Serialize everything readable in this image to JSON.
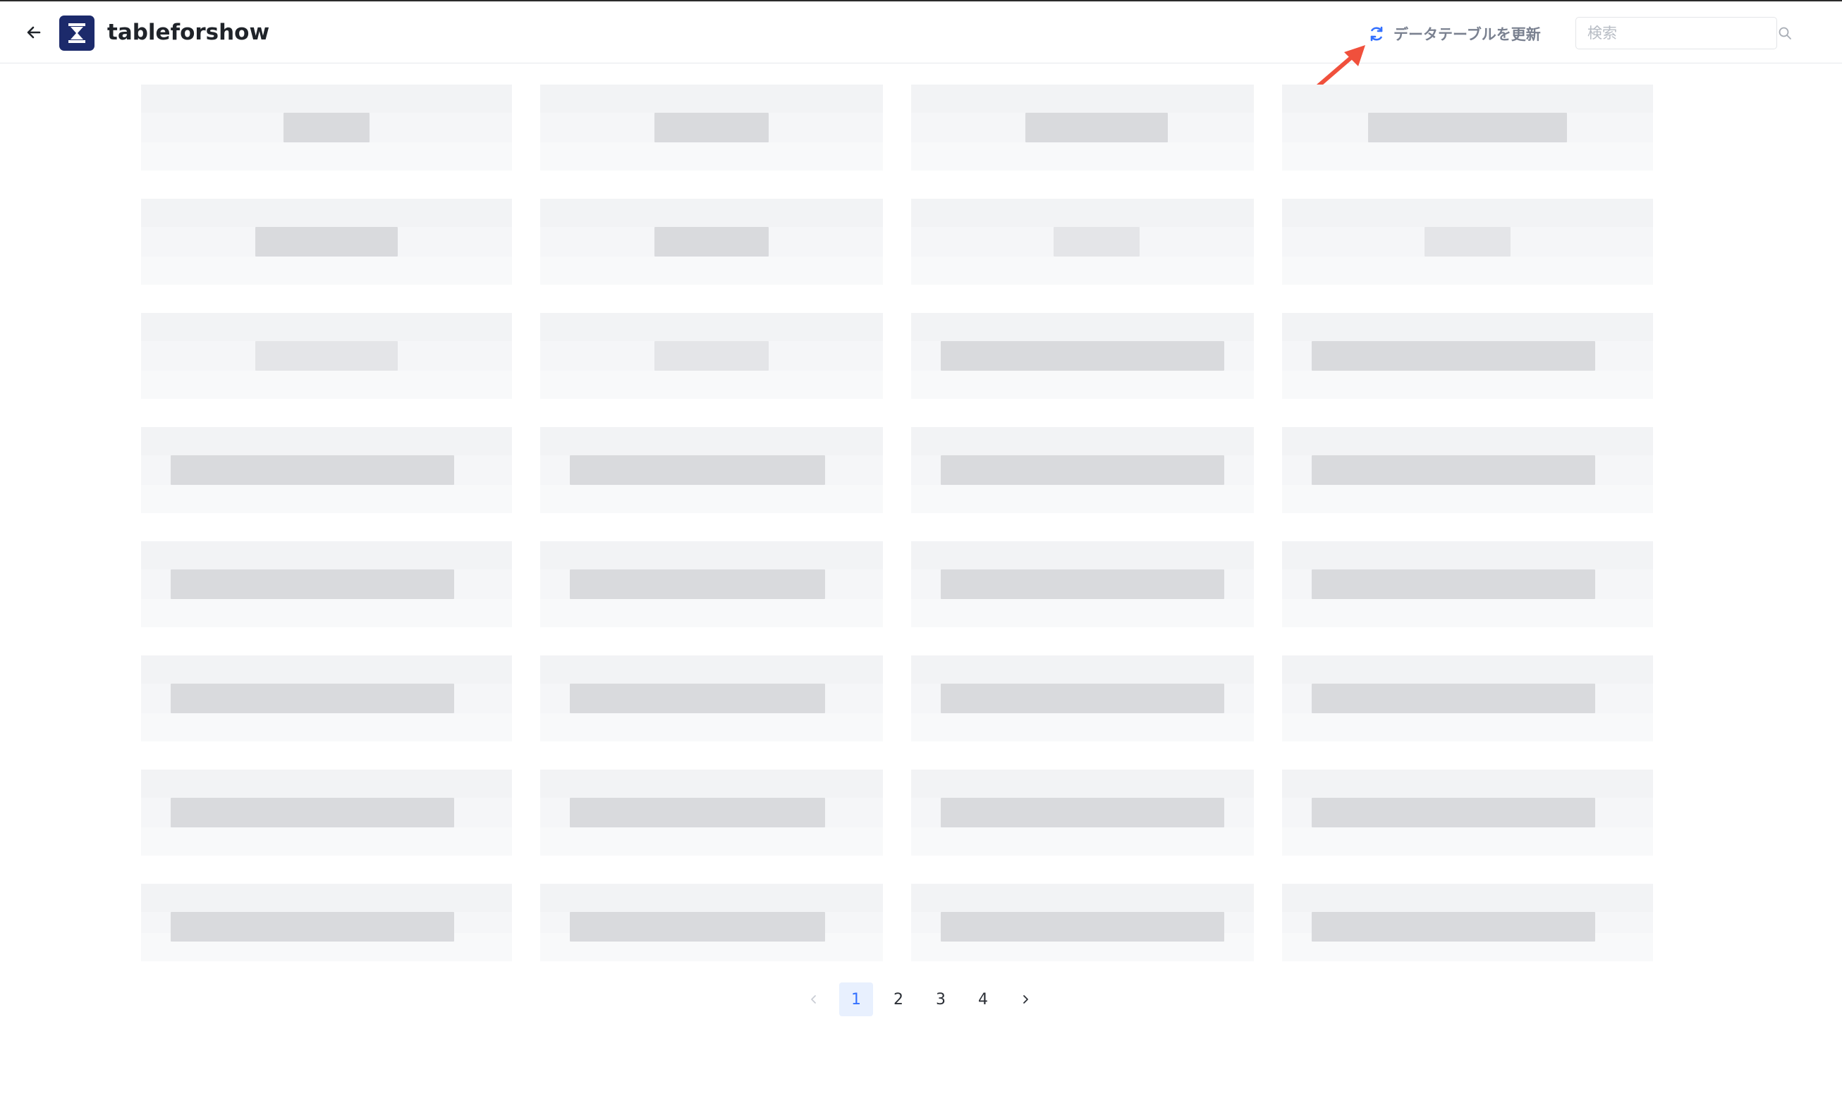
{
  "header": {
    "app_title": "tableforshow",
    "refresh_label": "データテーブルを更新",
    "search": {
      "placeholder": "検索",
      "value": ""
    }
  },
  "icons": [
    "back-arrow-icon",
    "hourglass-logo-icon",
    "refresh-icon",
    "search-icon",
    "chevron-left-icon",
    "chevron-right-icon"
  ],
  "colors": {
    "logo_bg": "#1c2a6b",
    "accent": "#3370ff",
    "annotation_arrow": "#f0503c",
    "muted_text": "#7a8190"
  },
  "pagination": {
    "pages": [
      "1",
      "2",
      "3",
      "4"
    ],
    "current": "1"
  }
}
